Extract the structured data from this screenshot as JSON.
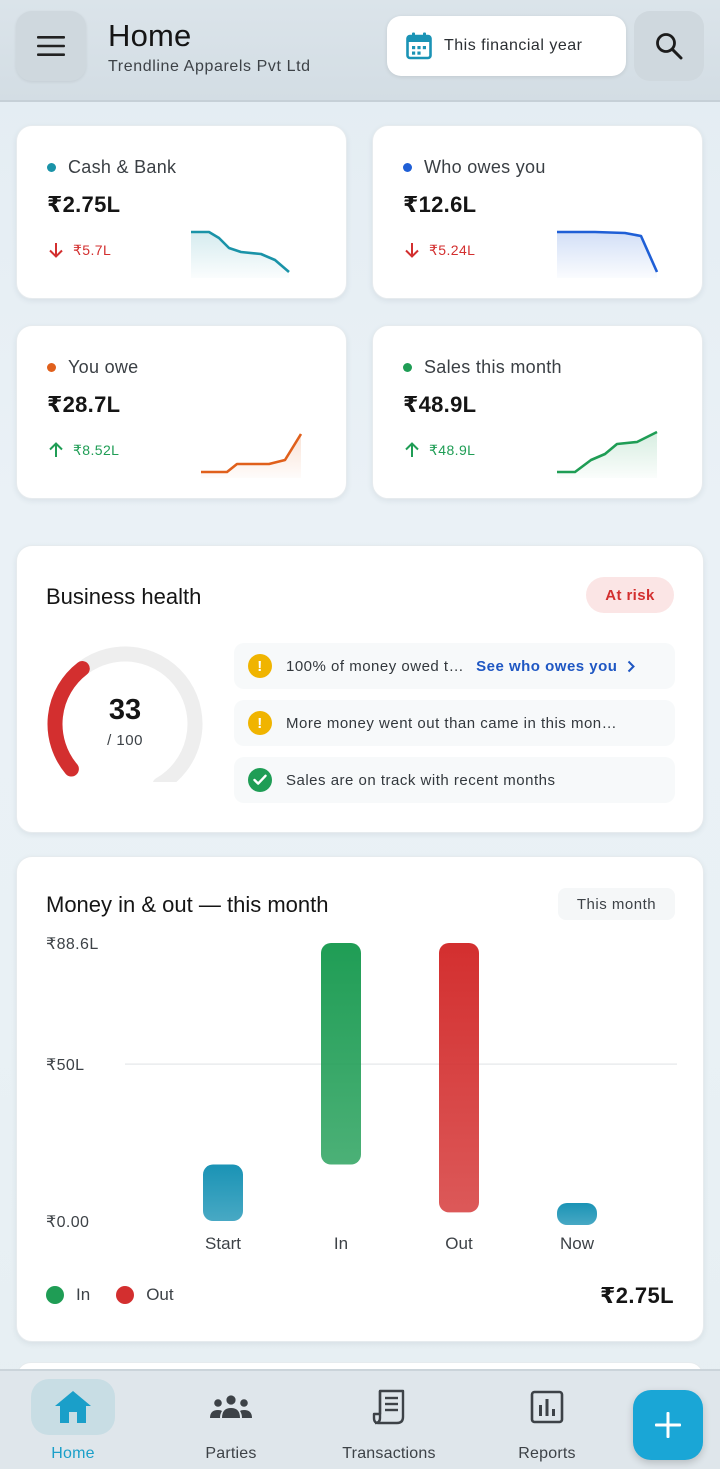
{
  "header": {
    "title": "Home",
    "subtitle": "Trendline Apparels Pvt Ltd",
    "period_label": "This financial year"
  },
  "stats": [
    {
      "label": "Cash & Bank",
      "value": "₹2.75L",
      "change": "₹5.7L",
      "direction": "down",
      "dot_color": "#1a93a8",
      "line_color": "#1a93a8",
      "change_color": "#d32f2f"
    },
    {
      "label": "Who owes you",
      "value": "₹12.6L",
      "change": "₹5.24L",
      "direction": "down",
      "dot_color": "#1f5fd6",
      "line_color": "#1f5fd6",
      "change_color": "#d32f2f"
    },
    {
      "label": "You owe",
      "value": "₹28.7L",
      "change": "₹8.52L",
      "direction": "up",
      "dot_color": "#e0601c",
      "line_color": "#e0601c",
      "change_color": "#1f9d55"
    },
    {
      "label": "Sales this month",
      "value": "₹48.9L",
      "change": "₹48.9L",
      "direction": "up",
      "dot_color": "#1f9d55",
      "line_color": "#1f9d55",
      "change_color": "#1f9d55"
    }
  ],
  "health": {
    "title": "Business health",
    "status": "At risk",
    "score": "33",
    "max": "/ 100",
    "score_value": 33,
    "insights": [
      {
        "type": "warning",
        "text": "100% of money owed t…",
        "link": "See who owes you"
      },
      {
        "type": "warning",
        "text": "More money went out than came in this mon…"
      },
      {
        "type": "ok",
        "text": "Sales are on track with recent months"
      }
    ]
  },
  "money": {
    "title": "Money in & out — this month",
    "period": "This month",
    "total": "₹2.75L",
    "legend": [
      {
        "name": "In",
        "color": "#1f9d55"
      },
      {
        "name": "Out",
        "color": "#d32f2f"
      }
    ]
  },
  "chart_data": {
    "type": "bar",
    "subtype": "waterfall",
    "categories": [
      "Start",
      "In",
      "Out",
      "Now"
    ],
    "ticks": [
      "₹88.6L",
      "₹50L",
      "₹0.00"
    ],
    "tick_values": [
      88.6,
      50,
      0
    ],
    "ylim": [
      0,
      88.6
    ],
    "bars": [
      {
        "category": "Start",
        "from": 0,
        "to": 18,
        "color": "#1a93b5"
      },
      {
        "category": "In",
        "from": 18,
        "to": 88.6,
        "color": "#1f9d55"
      },
      {
        "category": "Out",
        "from": 88.6,
        "to": 2.75,
        "color": "#d32f2f"
      },
      {
        "category": "Now",
        "from": 0,
        "to": 2.75,
        "color": "#1a93b5"
      }
    ]
  },
  "nav": [
    {
      "label": "Home",
      "icon": "home-icon",
      "active": true
    },
    {
      "label": "Parties",
      "icon": "parties-icon",
      "active": false
    },
    {
      "label": "Transactions",
      "icon": "transactions-icon",
      "active": false
    },
    {
      "label": "Reports",
      "icon": "reports-icon",
      "active": false
    }
  ],
  "fab_icon": "plus-icon"
}
